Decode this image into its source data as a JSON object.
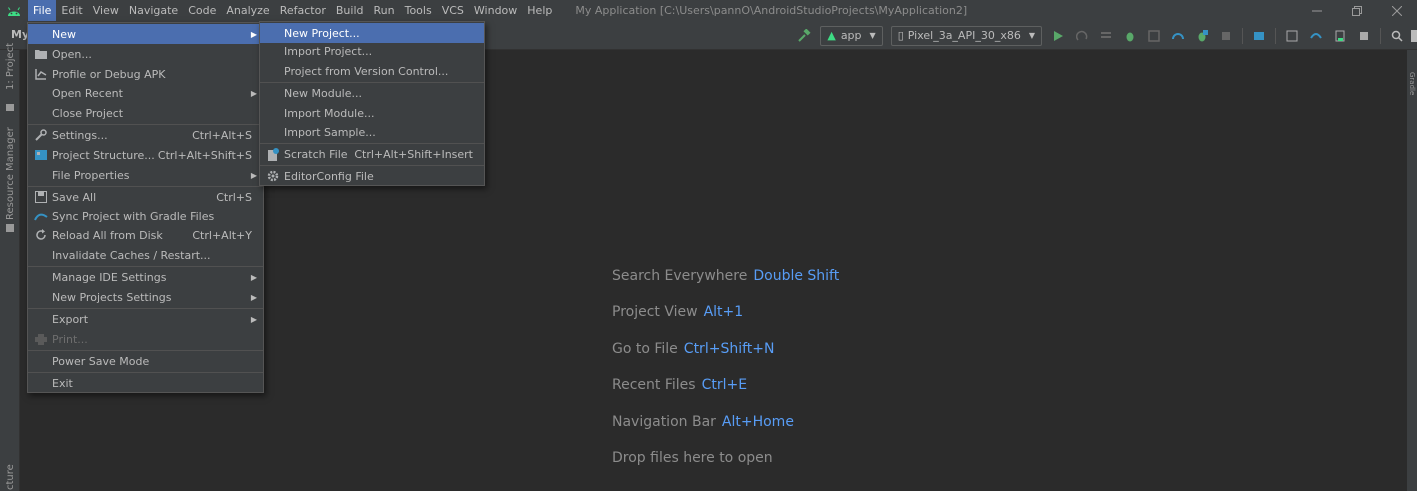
{
  "menubar": {
    "items": [
      {
        "label": "File",
        "active": true
      },
      {
        "label": "Edit"
      },
      {
        "label": "View"
      },
      {
        "label": "Navigate"
      },
      {
        "label": "Code"
      },
      {
        "label": "Analyze"
      },
      {
        "label": "Refactor"
      },
      {
        "label": "Build"
      },
      {
        "label": "Run"
      },
      {
        "label": "Tools"
      },
      {
        "label": "VCS"
      },
      {
        "label": "Window"
      },
      {
        "label": "Help"
      }
    ],
    "window_title": "My Application [C:\\Users\\pannO\\AndroidStudioProjects\\MyApplication2]"
  },
  "toolbar": {
    "project_label": "My",
    "run_config": "app",
    "device": "Pixel_3a_API_30_x86"
  },
  "left_stripe": {
    "project_tab": "1: Project",
    "resource_tab": "Resource Manager",
    "structure_tab": "cture"
  },
  "right_stripe": {
    "tab": "Gradle"
  },
  "file_menu": {
    "items": [
      {
        "label": "New",
        "submenu": true,
        "selected": true
      },
      {
        "label": "Open...",
        "icon": "folder-icon"
      },
      {
        "label": "Profile or Debug APK",
        "icon": "profile-icon"
      },
      {
        "label": "Open Recent",
        "submenu": true
      },
      {
        "label": "Close Project"
      },
      {
        "label": "Settings...",
        "shortcut": "Ctrl+Alt+S",
        "icon": "wrench-icon"
      },
      {
        "label": "Project Structure...",
        "shortcut": "Ctrl+Alt+Shift+S",
        "icon": "structure-icon"
      },
      {
        "label": "File Properties",
        "submenu": true
      },
      {
        "label": "Save All",
        "shortcut": "Ctrl+S",
        "icon": "save-icon"
      },
      {
        "label": "Sync Project with Gradle Files",
        "icon": "sync-icon"
      },
      {
        "label": "Reload All from Disk",
        "shortcut": "Ctrl+Alt+Y",
        "icon": "reload-icon"
      },
      {
        "label": "Invalidate Caches / Restart..."
      },
      {
        "label": "Manage IDE Settings",
        "submenu": true
      },
      {
        "label": "New Projects Settings",
        "submenu": true
      },
      {
        "label": "Export",
        "submenu": true
      },
      {
        "label": "Print...",
        "disabled": true,
        "icon": "print-icon"
      },
      {
        "label": "Power Save Mode"
      },
      {
        "label": "Exit"
      }
    ]
  },
  "new_menu": {
    "items": [
      {
        "label": "New Project...",
        "selected": true
      },
      {
        "label": "Import Project..."
      },
      {
        "label": "Project from Version Control..."
      },
      {
        "label": "New Module..."
      },
      {
        "label": "Import Module..."
      },
      {
        "label": "Import Sample..."
      },
      {
        "label": "Scratch File",
        "shortcut": "Ctrl+Alt+Shift+Insert",
        "icon": "scratch-file-icon"
      },
      {
        "label": "EditorConfig File",
        "icon": "gear-icon"
      }
    ]
  },
  "empty_state": {
    "hints": [
      {
        "label": "Search Everywhere",
        "key": "Double Shift"
      },
      {
        "label": "Project View",
        "key": "Alt+1"
      },
      {
        "label": "Go to File",
        "key": "Ctrl+Shift+N"
      },
      {
        "label": "Recent Files",
        "key": "Ctrl+E"
      },
      {
        "label": "Navigation Bar",
        "key": "Alt+Home"
      },
      {
        "label": "Drop files here to open",
        "key": ""
      }
    ]
  },
  "colors": {
    "background": "#2b2b2b",
    "panel": "#3c3f41",
    "selection": "#4b6eaf",
    "shortcut_blue": "#589df6",
    "android_green": "#3ddc84",
    "run_green": "#59a869"
  }
}
